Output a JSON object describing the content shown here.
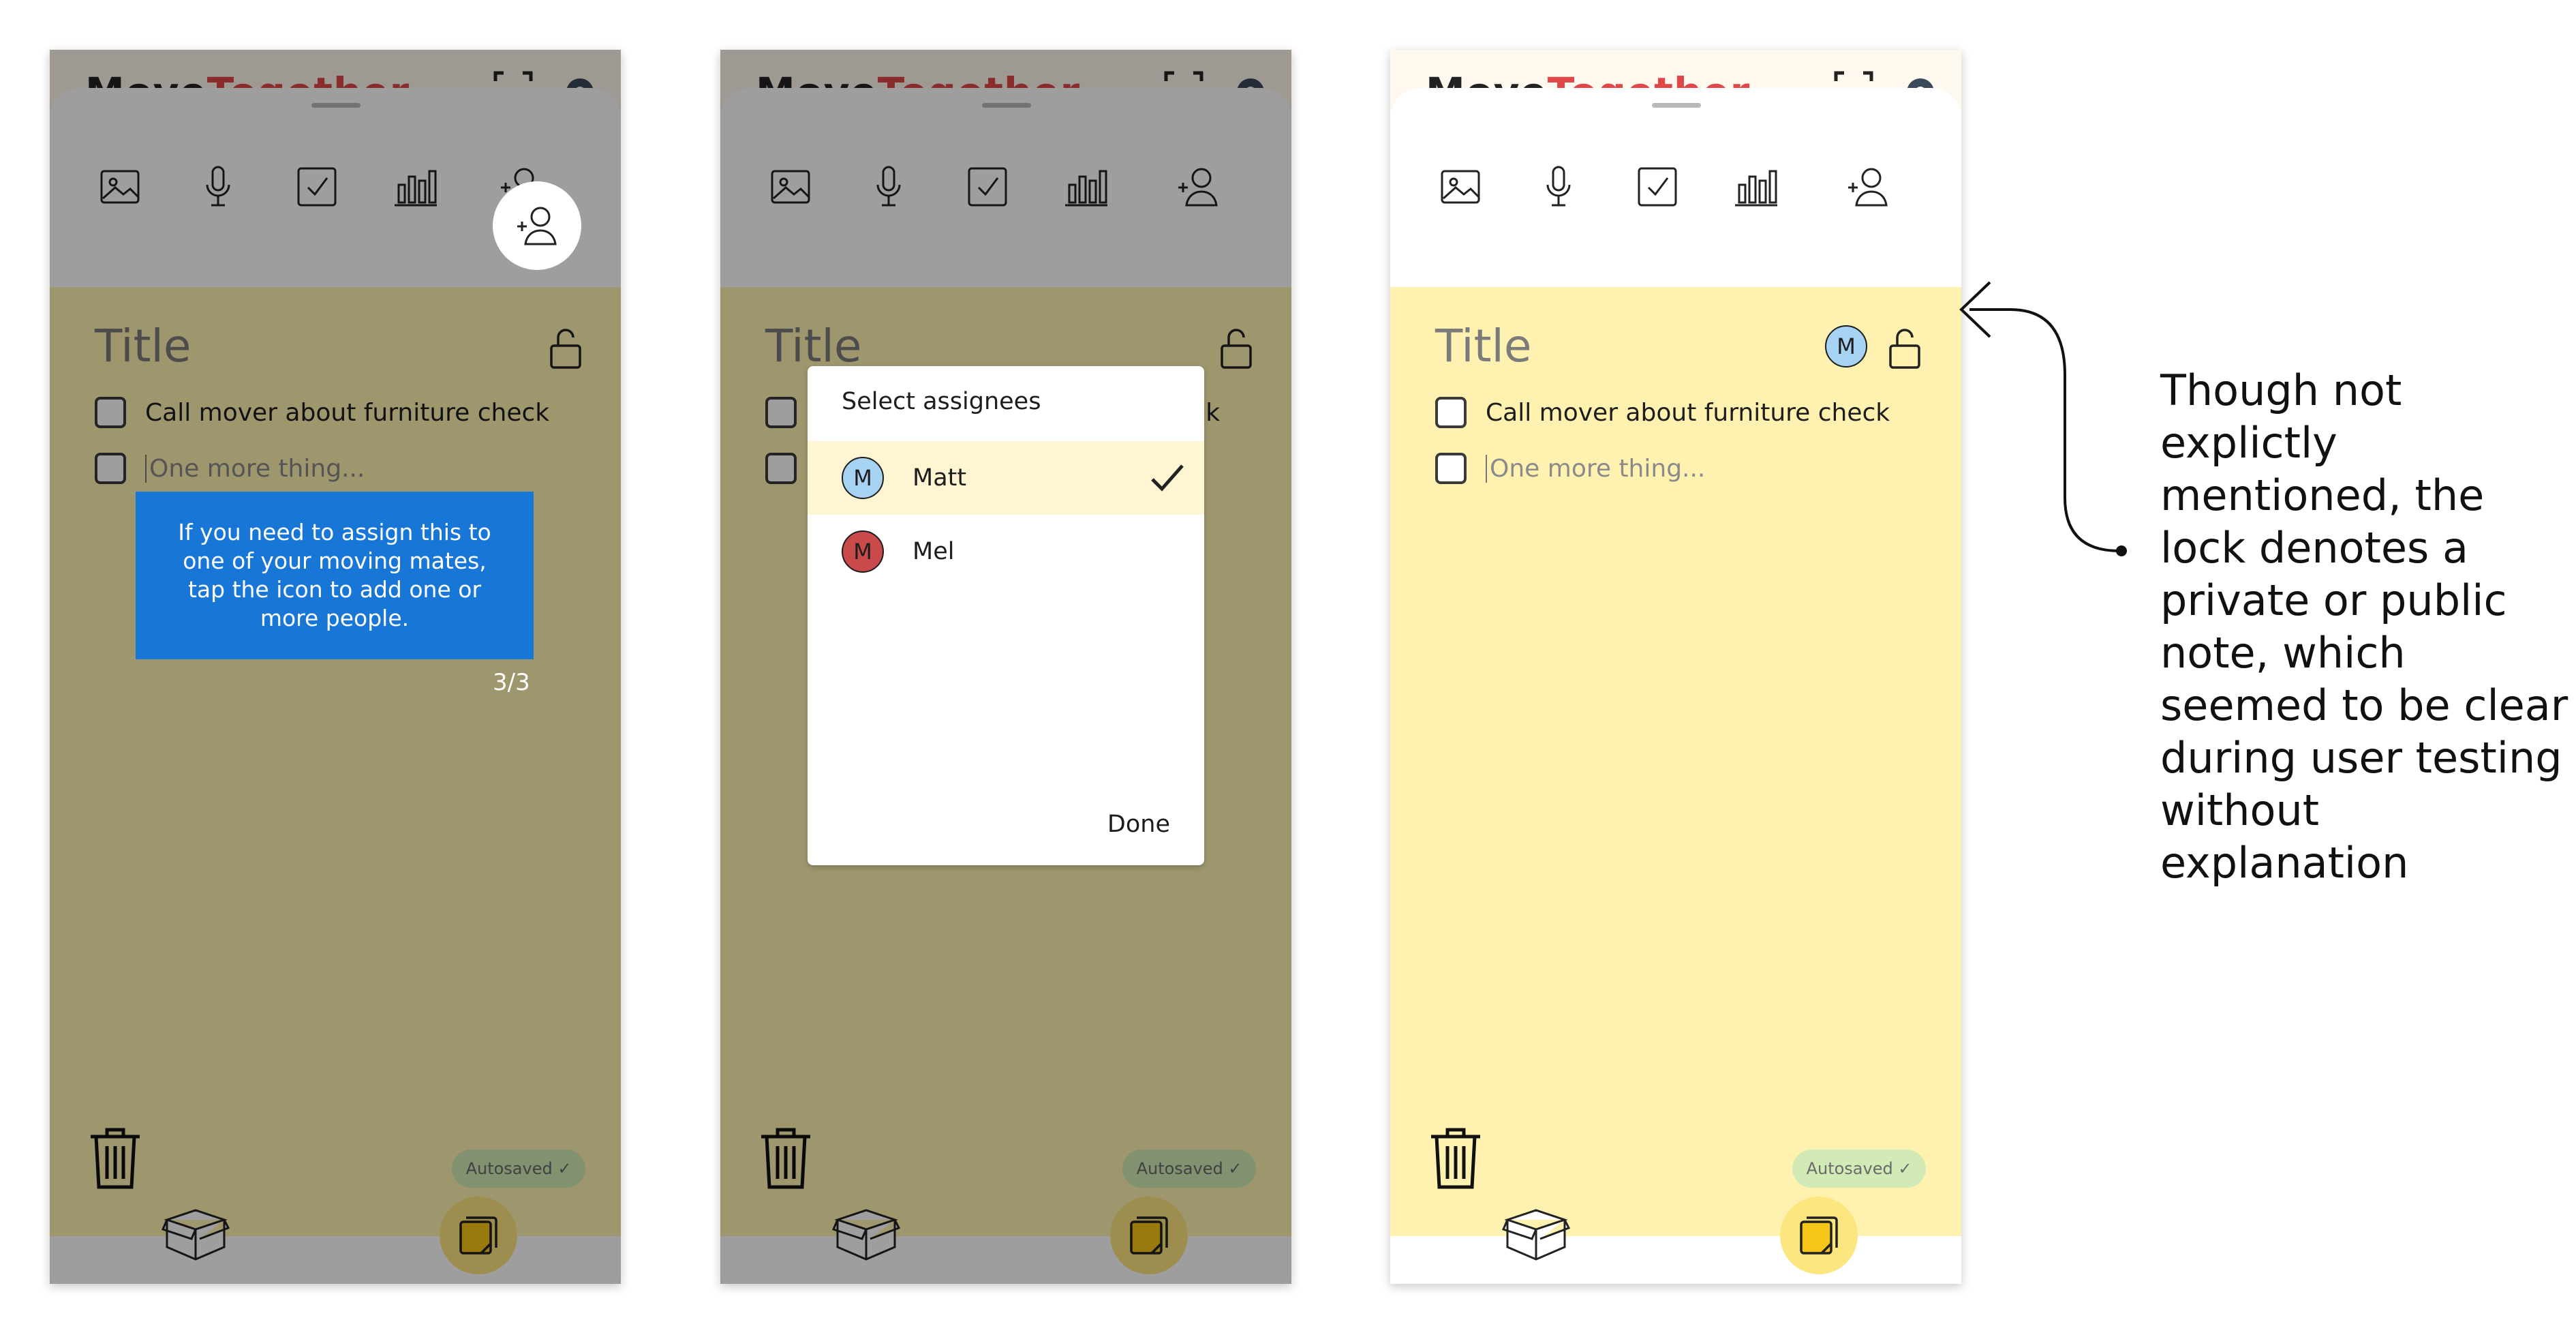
{
  "app": {
    "brand_part1": "Move",
    "brand_part2": "Together",
    "accent_color": "#e04848",
    "note_color": "#fff2b0"
  },
  "toolbar": {
    "icons": [
      "image-icon",
      "microphone-icon",
      "checklist-icon",
      "poll-icon",
      "add-person-icon"
    ]
  },
  "note": {
    "title_placeholder": "Title",
    "item1": "Call mover about furniture check",
    "item2_placeholder": "One more thing...",
    "autosave": "Autosaved ✓"
  },
  "screen1": {
    "tooltip": "If you need to assign this to one of your moving mates, tap the icon to add one or more people.",
    "pager": "3/3"
  },
  "screen2": {
    "dialog_title": "Select assignees",
    "options": [
      {
        "initial": "M",
        "name": "Matt",
        "selected": true,
        "color": "#a7d3f3"
      },
      {
        "initial": "M",
        "name": "Mel",
        "selected": false,
        "color": "#c84a4a"
      }
    ],
    "done_label": "Done"
  },
  "screen3": {
    "assignee_initial": "M"
  },
  "annotation": {
    "text": "Though not explictly mentioned, the lock denotes a private or public note, which seemed to be clear during user testing without explanation"
  },
  "bottom_nav": {
    "icons": [
      "box-icon",
      "notes-icon"
    ]
  }
}
